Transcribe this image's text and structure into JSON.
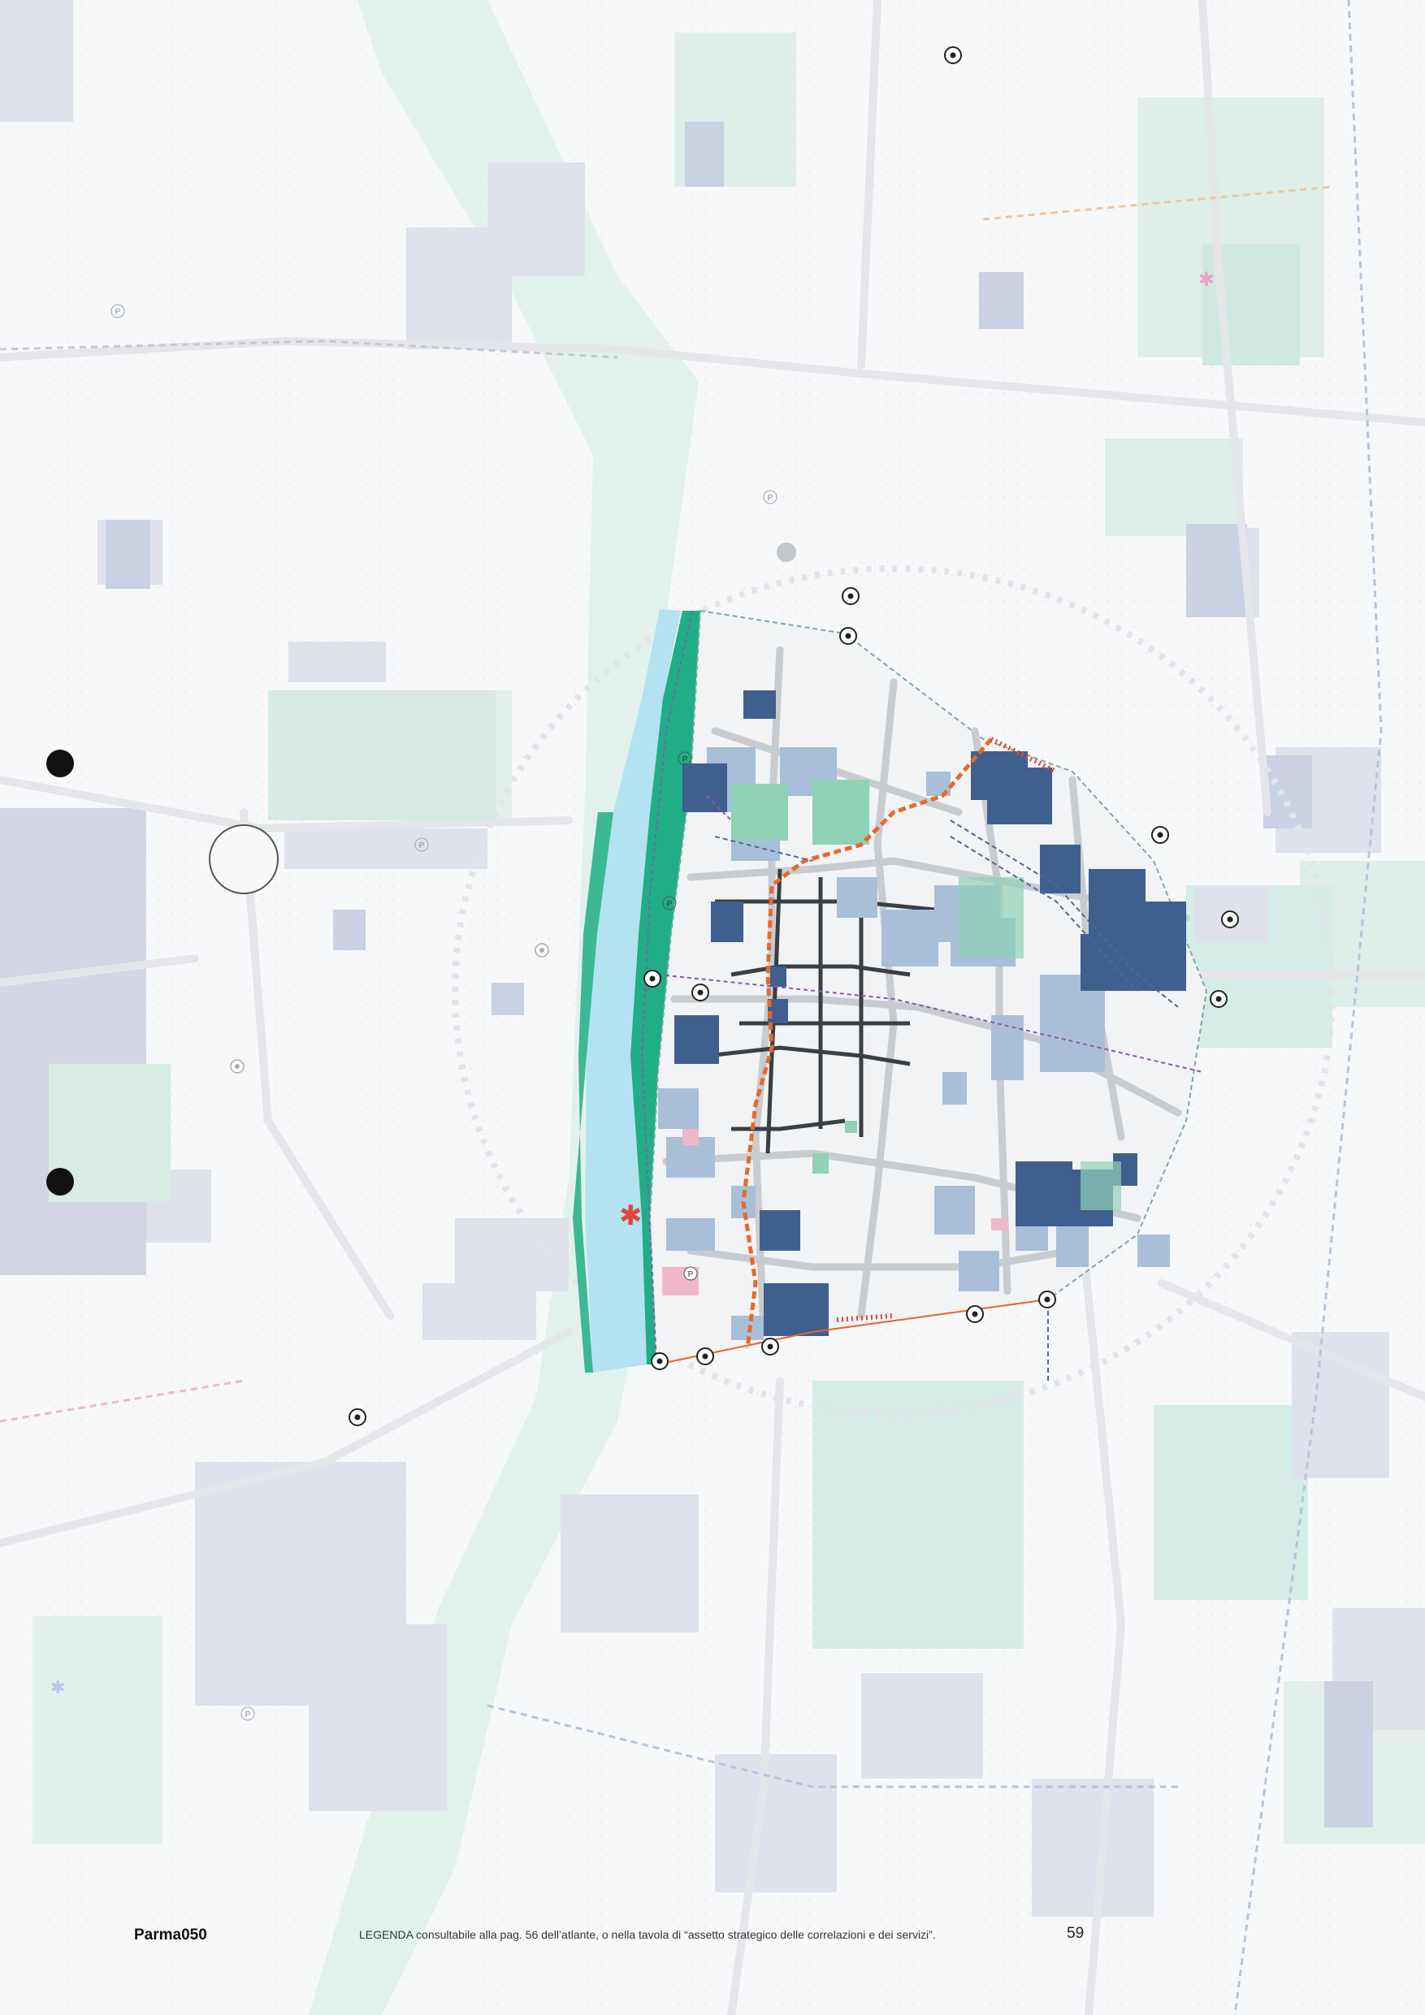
{
  "footer": {
    "brand": "Parma050",
    "legend_note": "LEGENDA consultabile alla pag. 56 dell’atlante, o nella tavola di “assetto strategico delle correlazioni e dei servizi”.",
    "page_number": "59"
  },
  "map": {
    "parking_symbol": "P",
    "highlight_star": "✱",
    "colors": {
      "background": "#f7f8f9",
      "block_light": "#d7dde4",
      "block_mid": "#a9bfd8",
      "block_dark": "#3f5f8e",
      "green_light": "#cfe9e1",
      "green_strong": "#1fae85",
      "river": "#b3e2f0",
      "route_orange": "#e8682c",
      "route_purple": "#8a5aa8",
      "pink": "#f2b6c9",
      "grey_road": "#c8ccd0"
    },
    "icons": [
      "transit-stop-icon",
      "parking-icon",
      "star-marker-icon",
      "large-dot-icon",
      "roundabout-icon"
    ]
  }
}
